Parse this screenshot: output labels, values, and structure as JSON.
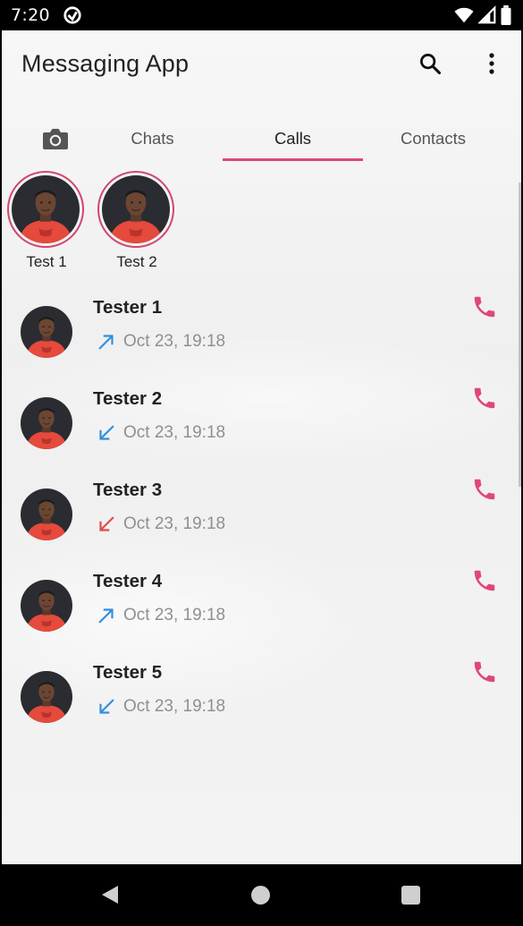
{
  "status_bar": {
    "time": "7:20",
    "icons": [
      "data-saver-icon",
      "wifi-icon",
      "signal-icon",
      "battery-icon"
    ]
  },
  "app_bar": {
    "title": "Messaging App",
    "actions": [
      "search-icon",
      "more-vert-icon"
    ]
  },
  "tabs": {
    "camera_icon": "camera-icon",
    "items": [
      {
        "label": "Chats",
        "active": false
      },
      {
        "label": "Calls",
        "active": true
      },
      {
        "label": "Contacts",
        "active": false
      }
    ]
  },
  "stories": [
    {
      "label": "Test 1"
    },
    {
      "label": "Test 2"
    }
  ],
  "calls": [
    {
      "name": "Tester 1",
      "direction": "outgoing",
      "time": "Oct 23, 19:18"
    },
    {
      "name": "Tester 2",
      "direction": "incoming",
      "time": "Oct 23, 19:18"
    },
    {
      "name": "Tester 3",
      "direction": "missed",
      "time": "Oct 23, 19:18"
    },
    {
      "name": "Tester 4",
      "direction": "outgoing",
      "time": "Oct 23, 19:18"
    },
    {
      "name": "Tester 5",
      "direction": "incoming",
      "time": "Oct 23, 19:18"
    }
  ],
  "colors": {
    "accent": "#e0467a",
    "outgoing": "#2f8fe0",
    "incoming": "#2f8fe0",
    "missed": "#e04a4a",
    "call_icon": "#e0467a"
  },
  "nav_bar": {
    "buttons": [
      "back-icon",
      "home-icon",
      "recents-icon"
    ]
  }
}
